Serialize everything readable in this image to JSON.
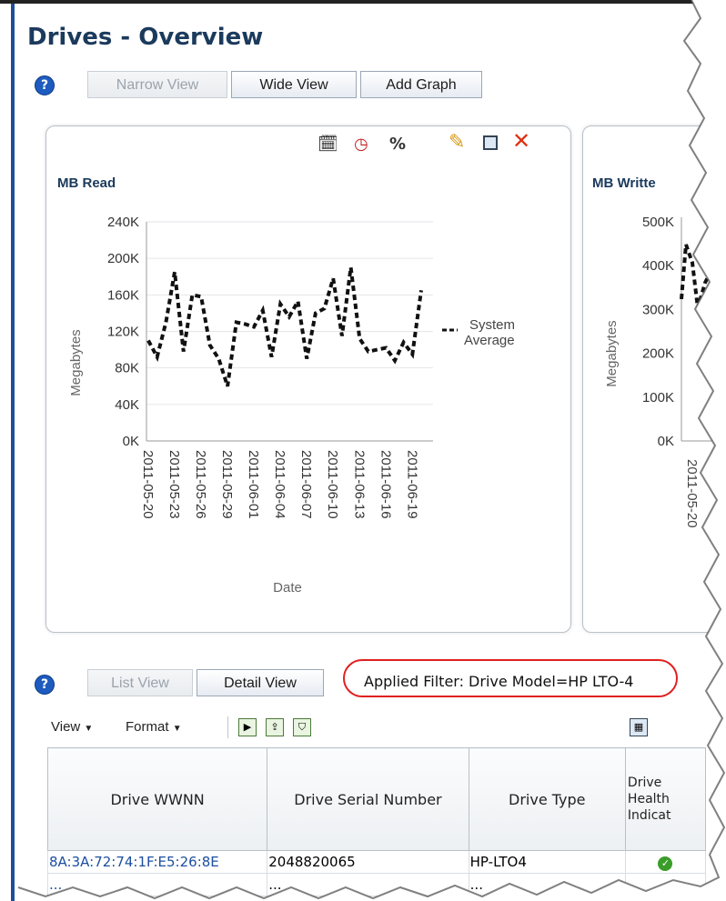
{
  "page": {
    "title": "Drives - Overview"
  },
  "toolbar": {
    "narrow_view": "Narrow View",
    "wide_view": "Wide View",
    "add_graph": "Add Graph"
  },
  "chart_read": {
    "title": "MB Read",
    "legend": "System\nAverage",
    "legend_line1": "System",
    "legend_line2": "Average",
    "y_ticks": [
      "240K",
      "200K",
      "160K",
      "120K",
      "80K",
      "40K",
      "0K"
    ],
    "x_ticks": [
      "2011-05-20",
      "2011-05-23",
      "2011-05-26",
      "2011-05-29",
      "2011-06-01",
      "2011-06-04",
      "2011-06-07",
      "2011-06-10",
      "2011-06-13",
      "2011-06-16",
      "2011-06-19"
    ],
    "ylabel": "Megabytes",
    "xlabel": "Date"
  },
  "chart_written": {
    "title": "MB Writte",
    "y_ticks": [
      "500K",
      "400K",
      "300K",
      "200K",
      "100K",
      "0K"
    ],
    "ylabel": "Megabytes",
    "x_tick": "2011-05-20"
  },
  "chart_data": [
    {
      "type": "line",
      "title": "MB Read",
      "xlabel": "Date",
      "ylabel": "Megabytes",
      "ylim": [
        0,
        240000
      ],
      "grid": true,
      "legend_placement": "right",
      "series": [
        {
          "name": "System Average",
          "x": [
            "2011-05-20",
            "2011-05-21",
            "2011-05-22",
            "2011-05-23",
            "2011-05-24",
            "2011-05-25",
            "2011-05-26",
            "2011-05-27",
            "2011-05-28",
            "2011-05-29",
            "2011-05-30",
            "2011-05-31",
            "2011-06-01",
            "2011-06-02",
            "2011-06-03",
            "2011-06-04",
            "2011-06-05",
            "2011-06-06",
            "2011-06-07",
            "2011-06-08",
            "2011-06-09",
            "2011-06-10",
            "2011-06-11",
            "2011-06-12",
            "2011-06-13",
            "2011-06-14",
            "2011-06-15",
            "2011-06-16",
            "2011-06-17",
            "2011-06-18",
            "2011-06-19",
            "2011-06-20"
          ],
          "values": [
            110000,
            92000,
            130000,
            185000,
            98000,
            160000,
            158000,
            105000,
            90000,
            60000,
            130000,
            128000,
            125000,
            143000,
            92000,
            150000,
            136000,
            153000,
            90000,
            140000,
            145000,
            178000,
            115000,
            190000,
            112000,
            98000,
            100000,
            102000,
            88000,
            108000,
            95000,
            165000
          ]
        }
      ]
    }
  ],
  "lower": {
    "list_view": "List View",
    "detail_view": "Detail View",
    "filter": "Applied Filter: Drive Model=HP LTO-4",
    "menu_view": "View",
    "menu_format": "Format"
  },
  "table": {
    "headers": [
      "Drive WWNN",
      "Drive Serial Number",
      "Drive Type",
      "Drive\nHealth\nIndicat"
    ],
    "health_header_lines": [
      "Drive",
      "Health",
      "Indicat"
    ],
    "rows": [
      {
        "wwnn": "8A:3A:72:74:1F:E5:26:8E",
        "serial": "2048820065",
        "type": "HP-LTO4",
        "health": "ok"
      },
      {
        "wwnn": "...",
        "serial": "...",
        "type": "...",
        "health": ""
      }
    ]
  },
  "colors": {
    "accent": "#1f4e99",
    "title": "#1b3a5c",
    "link": "#1d4fa0",
    "filter_highlight": "#e02020"
  }
}
